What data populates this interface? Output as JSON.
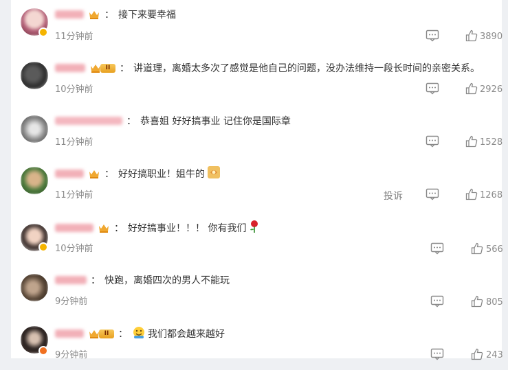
{
  "comments": [
    {
      "text": "接下来要幸福",
      "time": "11分钟前",
      "likes": "3890",
      "badge": "crown-small"
    },
    {
      "text": "讲道理，离婚太多次了感觉是他自己的问题，没办法维持一段长时间的亲密关系。",
      "time": "10分钟前",
      "likes": "2926",
      "badge": "crown-level",
      "level": "II"
    },
    {
      "text": "恭喜姐 好好搞事业 记住你是国际章",
      "time": "11分钟前",
      "likes": "1528",
      "badge": "none"
    },
    {
      "text": "好好搞职业！姐牛的",
      "time": "11分钟前",
      "likes": "1268",
      "badge": "crown-small",
      "emoji": "like-emoji"
    },
    {
      "text": "好好搞事业！！！ 你有我们",
      "time": "10分钟前",
      "likes": "566",
      "badge": "crown-small",
      "emoji": "rose-emoji"
    },
    {
      "text": "快跑，离婚四次的男人不能玩",
      "time": "9分钟前",
      "likes": "805",
      "badge": "none"
    },
    {
      "text": "我们都会越来越好",
      "time": "9分钟前",
      "likes": "243",
      "badge": "crown-level",
      "level": "II",
      "emoji": "smile-emoji"
    }
  ],
  "colon": "：",
  "report_label": "投诉",
  "icons": {
    "reply": "comment-bubble-icon",
    "like": "thumbs-up-icon"
  },
  "colors": {
    "meta": "#8a8a8a",
    "text": "#333333",
    "crown": "#e8a020"
  }
}
